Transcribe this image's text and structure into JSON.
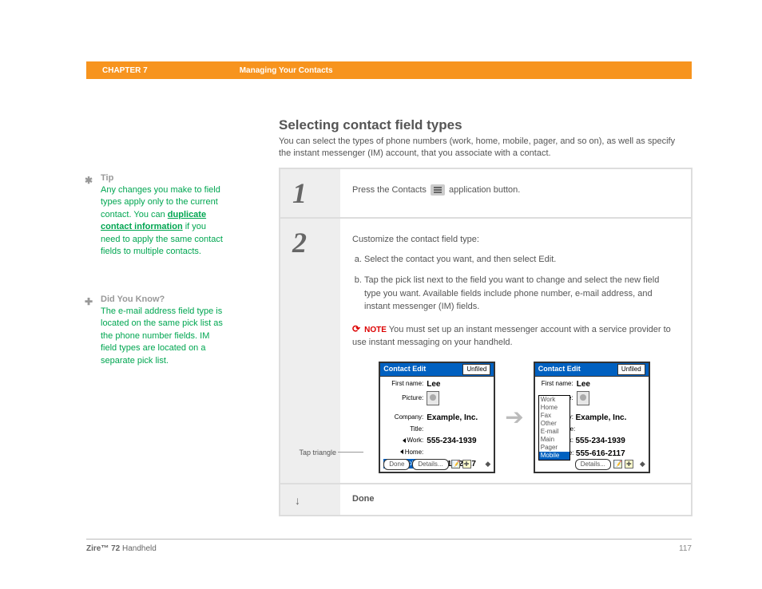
{
  "header": {
    "chapter": "CHAPTER 7",
    "title": "Managing Your Contacts"
  },
  "main": {
    "title": "Selecting contact field types",
    "intro": "You can select the types of phone numbers (work, home, mobile, pager, and so on), as well as specify the instant messenger (IM) account, that you associate with a contact."
  },
  "sidebar": {
    "tip": {
      "heading": "Tip",
      "body_pre": "Any changes you make to field types apply only to the current contact. You can ",
      "link": "duplicate contact information",
      "body_post": " if you need to apply the same contact fields to multiple contacts."
    },
    "dyk": {
      "heading": "Did You Know?",
      "body": "The e-mail address field type is located on the same pick list as the phone number fields. IM field types are located on a separate pick list."
    }
  },
  "steps": {
    "step1": {
      "num": "1",
      "text_pre": "Press the Contacts ",
      "text_post": " application button."
    },
    "step2": {
      "num": "2",
      "intro": "Customize the contact field type:",
      "a": "Select the contact you want, and then select Edit.",
      "b": "Tap the pick list next to the field you want to change and select the new field type you want. Available fields include phone number, e-mail address, and instant messenger (IM) fields.",
      "note_label": "NOTE",
      "note_text": "You must set up an instant messenger account with a service provider to use instant messaging on your handheld.",
      "callout": "Tap triangle"
    },
    "done": "Done"
  },
  "palm": {
    "title": "Contact Edit",
    "category": "Unfiled",
    "first_name_lbl": "First name:",
    "first_name": "Lee",
    "picture_lbl": "Picture:",
    "company_lbl": "Company:",
    "company": "Example, Inc.",
    "title_lbl": "Title:",
    "work_lbl": "Work:",
    "work": "555-234-1939",
    "home_lbl": "Home:",
    "mobile_lbl": "Mobile",
    "mobile": "555-616-2117",
    "btn_done": "Done",
    "btn_details": "Details...",
    "picklist": [
      "Work",
      "Home",
      "Fax",
      "Other",
      "E-mail",
      "Main",
      "Pager",
      "Mobile"
    ],
    "right_lbl_le": "le:",
    "right_lbl_k": "k:",
    "right_lbl_e": "e:"
  },
  "footer": {
    "product_bold": "Zire™ 72",
    "product_rest": " Handheld",
    "page": "117"
  }
}
